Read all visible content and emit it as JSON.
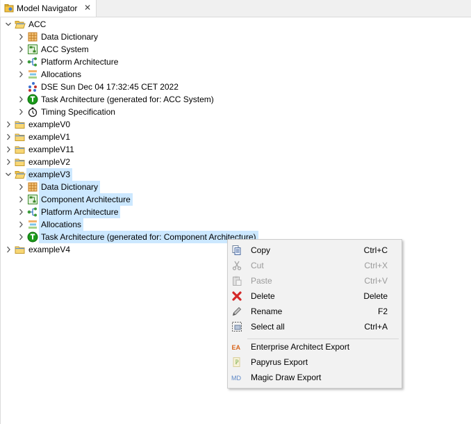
{
  "view": {
    "title": "Model Navigator",
    "close_glyph": "✕"
  },
  "tree": [
    {
      "level": 0,
      "expanded": true,
      "icon": "folder-open-icon",
      "label": "ACC",
      "selected": false
    },
    {
      "level": 1,
      "expanded": false,
      "icon": "data-dictionary-icon",
      "label": "Data Dictionary",
      "selected": false
    },
    {
      "level": 1,
      "expanded": false,
      "icon": "component-icon",
      "label": "ACC System",
      "selected": false
    },
    {
      "level": 1,
      "expanded": false,
      "icon": "platform-icon",
      "label": "Platform Architecture",
      "selected": false
    },
    {
      "level": 1,
      "expanded": false,
      "icon": "allocations-icon",
      "label": "Allocations",
      "selected": false
    },
    {
      "level": 1,
      "expanded": null,
      "icon": "dse-icon",
      "label": "DSE Sun Dec 04 17:32:45 CET 2022",
      "selected": false
    },
    {
      "level": 1,
      "expanded": false,
      "icon": "task-icon",
      "label": "Task Architecture (generated for: ACC System)",
      "selected": false
    },
    {
      "level": 1,
      "expanded": false,
      "icon": "timing-icon",
      "label": "Timing Specification",
      "selected": false
    },
    {
      "level": 0,
      "expanded": false,
      "icon": "folder-icon",
      "label": "exampleV0",
      "selected": false
    },
    {
      "level": 0,
      "expanded": false,
      "icon": "folder-icon",
      "label": "exampleV1",
      "selected": false
    },
    {
      "level": 0,
      "expanded": false,
      "icon": "folder-icon",
      "label": "exampleV11",
      "selected": false
    },
    {
      "level": 0,
      "expanded": false,
      "icon": "folder-icon",
      "label": "exampleV2",
      "selected": false
    },
    {
      "level": 0,
      "expanded": true,
      "icon": "folder-open-icon",
      "label": "exampleV3",
      "selected": true
    },
    {
      "level": 1,
      "expanded": false,
      "icon": "data-dictionary-icon",
      "label": "Data Dictionary",
      "selected": true
    },
    {
      "level": 1,
      "expanded": false,
      "icon": "component-icon",
      "label": "Component Architecture",
      "selected": true
    },
    {
      "level": 1,
      "expanded": false,
      "icon": "platform-icon",
      "label": "Platform Architecture",
      "selected": true
    },
    {
      "level": 1,
      "expanded": false,
      "icon": "allocations-icon",
      "label": "Allocations",
      "selected": true
    },
    {
      "level": 1,
      "expanded": false,
      "icon": "task-icon",
      "label": "Task Architecture (generated for: Component Architecture)",
      "selected": true
    },
    {
      "level": 0,
      "expanded": false,
      "icon": "folder-icon",
      "label": "exampleV4",
      "selected": false
    }
  ],
  "context_menu": {
    "groups": [
      [
        {
          "icon": "copy-icon",
          "label": "Copy",
          "shortcut": "Ctrl+C",
          "enabled": true
        },
        {
          "icon": "cut-icon",
          "label": "Cut",
          "shortcut": "Ctrl+X",
          "enabled": false
        },
        {
          "icon": "paste-icon",
          "label": "Paste",
          "shortcut": "Ctrl+V",
          "enabled": false
        },
        {
          "icon": "delete-icon",
          "label": "Delete",
          "shortcut": "Delete",
          "enabled": true
        },
        {
          "icon": "rename-icon",
          "label": "Rename",
          "shortcut": "F2",
          "enabled": true
        },
        {
          "icon": "select-all-icon",
          "label": "Select all",
          "shortcut": "Ctrl+A",
          "enabled": true
        }
      ],
      [
        {
          "icon": "ea-export-icon",
          "label": "Enterprise Architect Export",
          "shortcut": "",
          "enabled": true
        },
        {
          "icon": "papyrus-export-icon",
          "label": "Papyrus Export",
          "shortcut": "",
          "enabled": true
        },
        {
          "icon": "magicdraw-export-icon",
          "label": "Magic Draw Export",
          "shortcut": "",
          "enabled": true
        }
      ]
    ]
  },
  "colors": {
    "selection": "#cce8ff",
    "menu_bg": "#f2f2f2",
    "disabled_text": "#9a9a9a"
  }
}
